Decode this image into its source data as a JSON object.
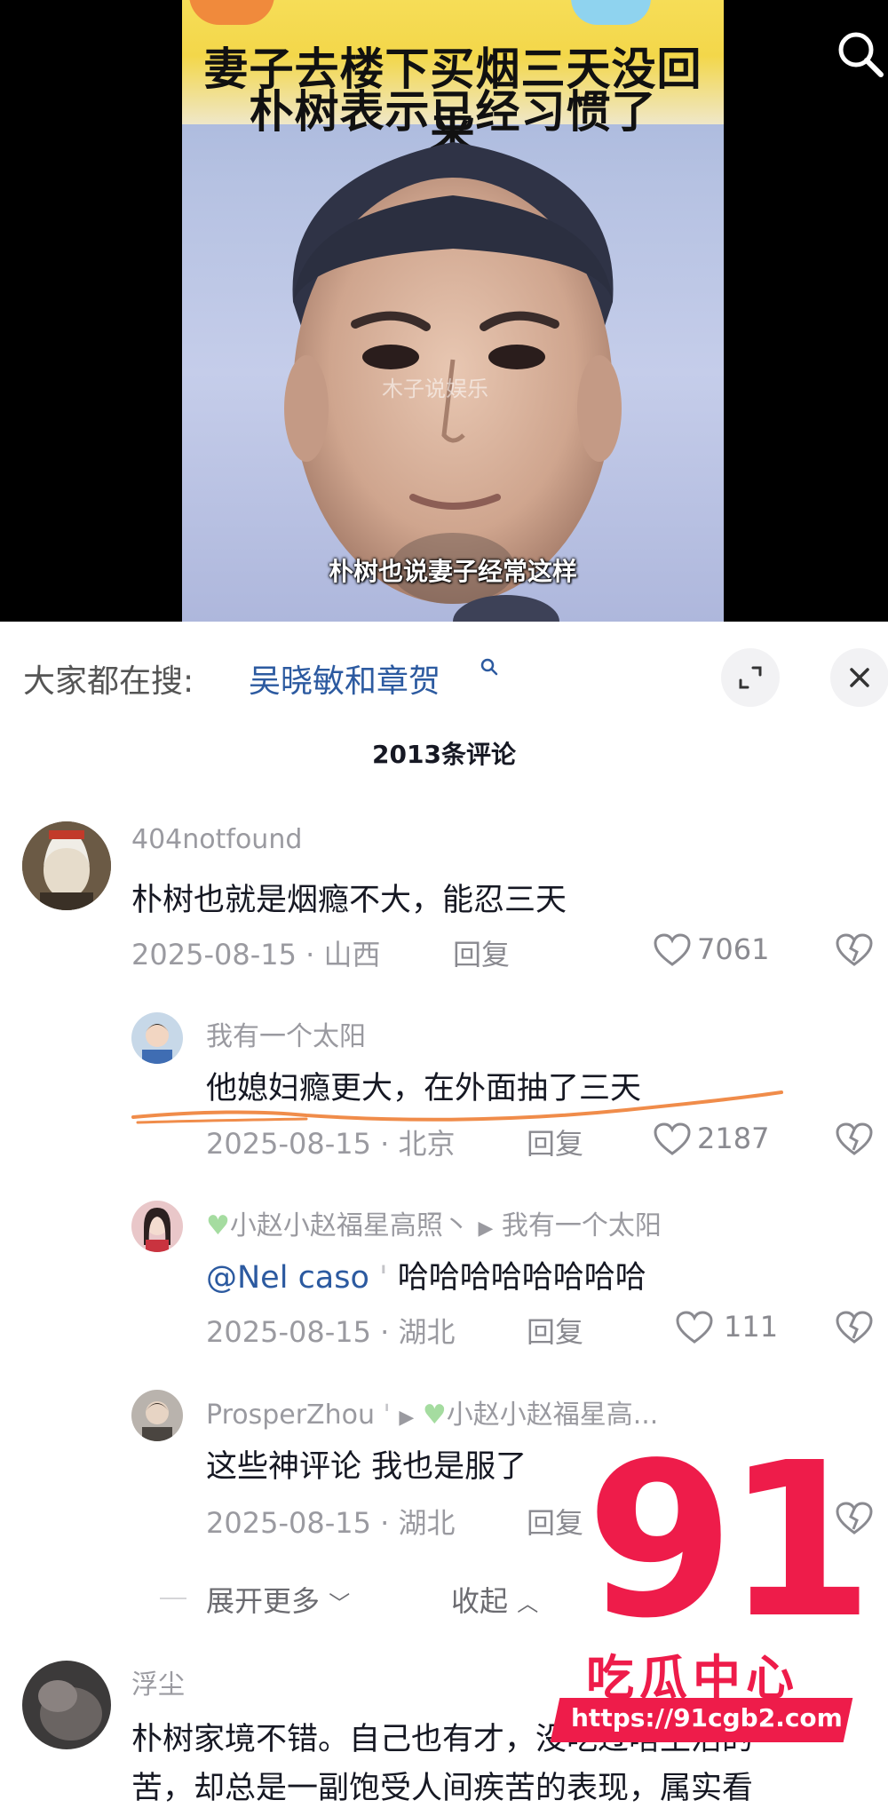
{
  "video": {
    "banner_line1": "妻子去楼下买烟三天没回来",
    "banner_line2": "朴树表示已经习惯了",
    "watermark": "木子说娱乐",
    "subtitle": "朴树也说妻子经常这样"
  },
  "suggest": {
    "prefix": "大家都在搜:",
    "term": "吴晓敏和章贺"
  },
  "comment_count": "2013条评论",
  "comments": [
    {
      "user": "404notfound",
      "text": "朴树也就是烟瘾不大，能忍三天",
      "meta": "2025-08-15 · 山西",
      "reply": "回复",
      "likes": "7061"
    },
    {
      "user": "我有一个太阳",
      "text": "他媳妇瘾更大，在外面抽了三天",
      "meta": "2025-08-15 · 北京",
      "reply": "回复",
      "likes": "2187"
    },
    {
      "user": "小赵小赵福星高照丶",
      "reply_to": "我有一个太阳",
      "mention": "@Nel caso",
      "text": "哈哈哈哈哈哈哈哈",
      "meta": "2025-08-15 · 湖北",
      "reply": "回复",
      "likes": "111"
    },
    {
      "user": "ProsperZhou",
      "reply_to": "小赵小赵福星高...",
      "text": "这些神评论 我也是服了",
      "meta": "2025-08-15 · 湖北",
      "reply": "回复"
    },
    {
      "user": "浮尘",
      "text": "朴树家境不错。自己也有才，没吃过啥生活的",
      "text2": "苦，却总是一副饱受人间疾苦的表现，属实看"
    }
  ],
  "thread": {
    "expand_more": "展开更多",
    "collapse": "收起"
  },
  "logo": {
    "number": "91",
    "name": "吃瓜中心",
    "url": "https://91cgb2.com"
  },
  "colors": {
    "accent_link": "#2c5aa0",
    "logo_red": "#ee1c4a",
    "annotation_orange": "#f08c4a"
  }
}
